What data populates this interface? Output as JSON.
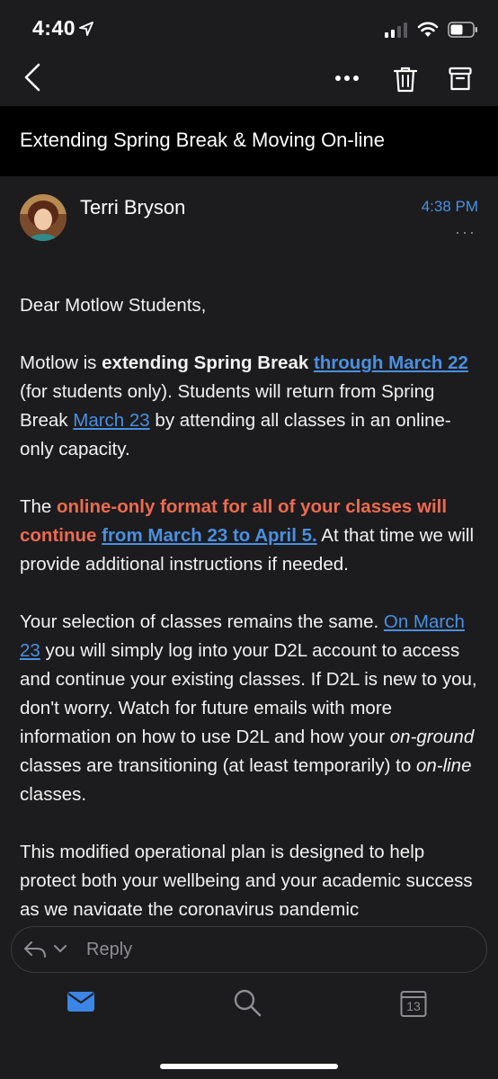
{
  "status": {
    "time": "4:40"
  },
  "toolbar": {
    "back": "back",
    "more": "more",
    "delete": "delete",
    "archive": "archive"
  },
  "subject": "Extending Spring Break & Moving On-line",
  "sender": {
    "name": "Terri Bryson",
    "time": "4:38 PM",
    "more": "···"
  },
  "body": {
    "greeting": "Dear Motlow Students,",
    "p1": {
      "t1": "Motlow is ",
      "b1": "extending Spring Break",
      "l1": "through March 22",
      "t2": " (for students only). Students will return from Spring Break ",
      "l2": "March 23",
      "t3": " by attending all classes in an online-only capacity."
    },
    "p2": {
      "t1": "The ",
      "r1": "online-only format for all of your classes will continue",
      "l1": "from March 23 to April 5.",
      "t2": " At that time we will provide additional instructions if needed."
    },
    "p3": {
      "t1": "Your selection of classes remains the same. ",
      "l1": "On March 23",
      "t2": " you will simply log into your D2L account to access and continue your existing classes. If D2L is new to you, don't worry. Watch for future emails with more information on how to use D2L and how your ",
      "i1": "on-ground",
      "t3": " classes are transitioning (at least temporarily) to ",
      "i2": "on-line",
      "t4": " classes."
    },
    "p4": "This modified operational plan is designed to help protect both your wellbeing and your academic success as we navigate the coronavirus pandemic"
  },
  "reply": {
    "placeholder": "Reply"
  },
  "tabs": {
    "calendar_day": "13"
  },
  "colors": {
    "accent": "#4a90e2",
    "highlight": "#ee6a4f",
    "background": "#1c1c1e",
    "subject_bg": "#000000"
  }
}
